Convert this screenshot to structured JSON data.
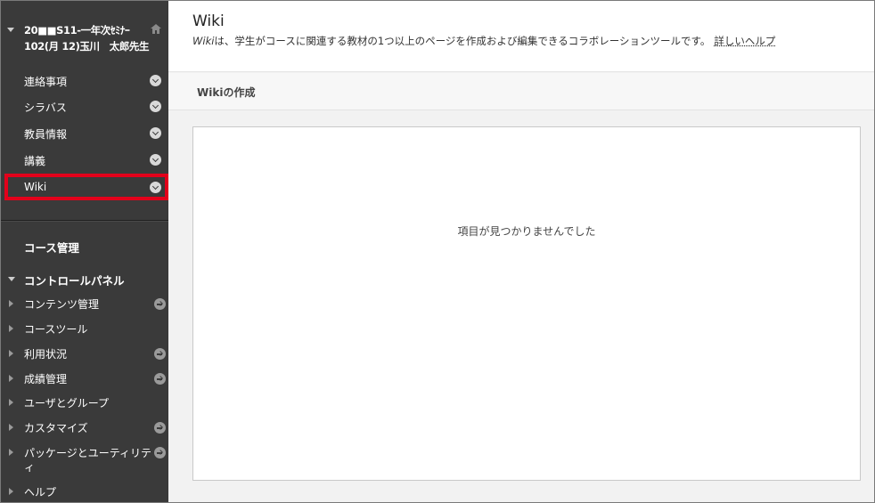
{
  "sidebar": {
    "course_title": "20■■S11-一年次ｾﾐﾅｰ102(月 12)玉川　太郎先生",
    "menu": [
      {
        "label": "連絡事項"
      },
      {
        "label": "シラバス"
      },
      {
        "label": "教員情報"
      },
      {
        "label": "講義"
      },
      {
        "label": "Wiki"
      }
    ],
    "course_management": "コース管理",
    "control_panel": "コントロールパネル",
    "tools": [
      {
        "label": "コンテンツ管理"
      },
      {
        "label": "コースツール"
      },
      {
        "label": "利用状況"
      },
      {
        "label": "成績管理"
      },
      {
        "label": "ユーザとグループ"
      },
      {
        "label": "カスタマイズ"
      },
      {
        "label": "パッケージとユーティリティ"
      },
      {
        "label": "ヘルプ"
      }
    ],
    "highlight_color": "#e3001b",
    "bg_color": "#3a3a3a"
  },
  "main": {
    "title": "Wiki",
    "desc_italic": "Wiki",
    "desc_rest": "は、学生がコースに関連する教材の1つ以上のページを作成および編集できるコラボレーションツールです。",
    "help_link": "詳しいヘルプ",
    "create_button": "Wikiの作成",
    "empty_message": "項目が見つかりませんでした"
  }
}
